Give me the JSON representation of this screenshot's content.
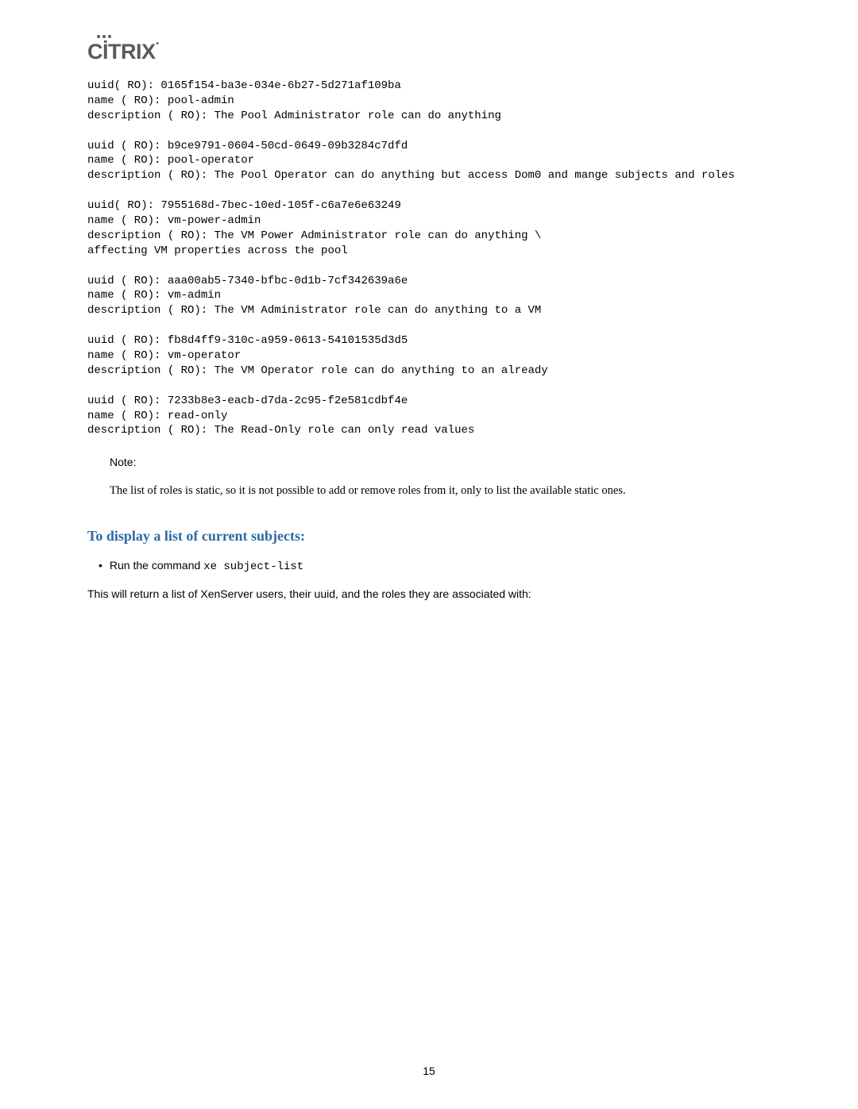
{
  "logo_text": "CİTRIX",
  "code_output": "uuid( RO): 0165f154-ba3e-034e-6b27-5d271af109ba\nname ( RO): pool-admin\ndescription ( RO): The Pool Administrator role can do anything\n\nuuid ( RO): b9ce9791-0604-50cd-0649-09b3284c7dfd\nname ( RO): pool-operator\ndescription ( RO): The Pool Operator can do anything but access Dom0 and mange subjects and roles\n\nuuid( RO): 7955168d-7bec-10ed-105f-c6a7e6e63249\nname ( RO): vm-power-admin\ndescription ( RO): The VM Power Administrator role can do anything \\\naffecting VM properties across the pool\n\nuuid ( RO): aaa00ab5-7340-bfbc-0d1b-7cf342639a6e\nname ( RO): vm-admin\ndescription ( RO): The VM Administrator role can do anything to a VM\n\nuuid ( RO): fb8d4ff9-310c-a959-0613-54101535d3d5\nname ( RO): vm-operator\ndescription ( RO): The VM Operator role can do anything to an already\n\nuuid ( RO): 7233b8e3-eacb-d7da-2c95-f2e581cdbf4e\nname ( RO): read-only\ndescription ( RO): The Read-Only role can only read values",
  "note": {
    "label": "Note:",
    "text": "The list of roles is static, so it is not possible to add or remove roles from it, only to list the available static ones."
  },
  "section_title": "To display a list of current subjects:",
  "bullet": {
    "lead": "Run the command ",
    "command": "xe subject-list"
  },
  "body_paragraph": "This will return a list of XenServer users, their uuid, and the roles they are associated with:",
  "page_number": "15"
}
